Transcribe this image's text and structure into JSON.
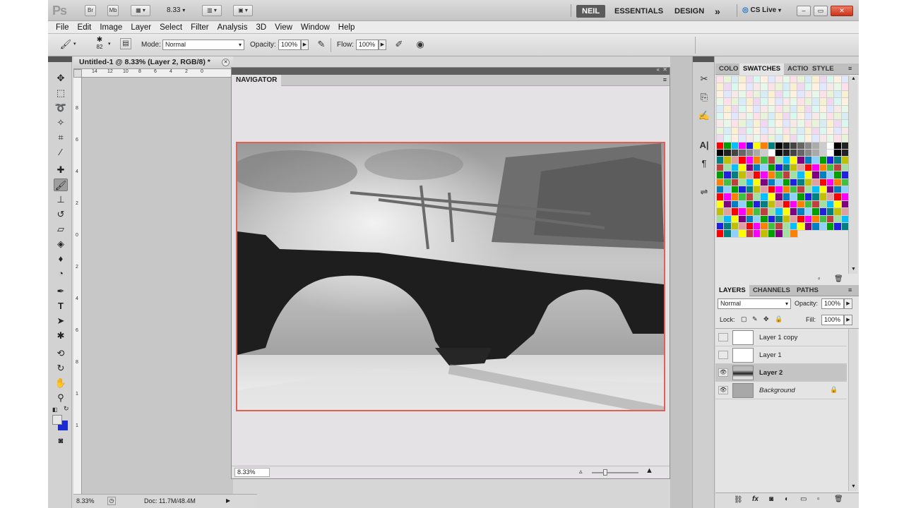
{
  "app": {
    "logo": "Ps",
    "bridge_btn": "Br",
    "minibridge_btn": "Mb",
    "zoom": "8.33",
    "workspaces": [
      "NEIL",
      "ESSENTIALS",
      "DESIGN"
    ],
    "more": "»",
    "cslive": "CS Live",
    "win_min": "–",
    "win_max": "▭",
    "win_close": "✕"
  },
  "menu": [
    "File",
    "Edit",
    "Image",
    "Layer",
    "Select",
    "Filter",
    "Analysis",
    "3D",
    "View",
    "Window",
    "Help"
  ],
  "options": {
    "brush_size": "82",
    "mode_label": "Mode:",
    "mode_value": "Normal",
    "opacity_label": "Opacity:",
    "opacity_value": "100%",
    "flow_label": "Flow:",
    "flow_value": "100%"
  },
  "document": {
    "tab_title": "Untitled-1 @ 8.33% (Layer 2, RGB/8) *",
    "ruler_h": [
      "14",
      "12",
      "10",
      "8",
      "6",
      "4",
      "2",
      "0"
    ],
    "ruler_v": [
      "8",
      "6",
      "4",
      "2",
      "0",
      "2",
      "4",
      "6",
      "8",
      "1",
      "1"
    ],
    "status_zoom": "8.33%",
    "status_doc": "Doc: 11.7M/48.4M"
  },
  "navigator": {
    "title": "NAVIGATOR",
    "zoom": "8.33%"
  },
  "swatches_panel": {
    "tabs": [
      "COLO",
      "SWATCHES",
      "ACTIO",
      "STYLE"
    ],
    "active_tab": "SWATCHES"
  },
  "layers_panel": {
    "tabs": [
      "LAYERS",
      "CHANNELS",
      "PATHS"
    ],
    "blend_mode": "Normal",
    "opacity_label": "Opacity:",
    "opacity_value": "100%",
    "lock_label": "Lock:",
    "fill_label": "Fill:",
    "fill_value": "100%",
    "layers": [
      {
        "name": "Layer 1 copy",
        "visible": false,
        "selected": false
      },
      {
        "name": "Layer 1",
        "visible": false,
        "selected": false
      },
      {
        "name": "Layer 2",
        "visible": true,
        "selected": true
      },
      {
        "name": "Background",
        "visible": true,
        "selected": false,
        "locked": true
      }
    ]
  },
  "colors": {
    "navigator_border": "#e06058",
    "foreground": "#e6e6e6",
    "background": "#1a2ad0"
  }
}
